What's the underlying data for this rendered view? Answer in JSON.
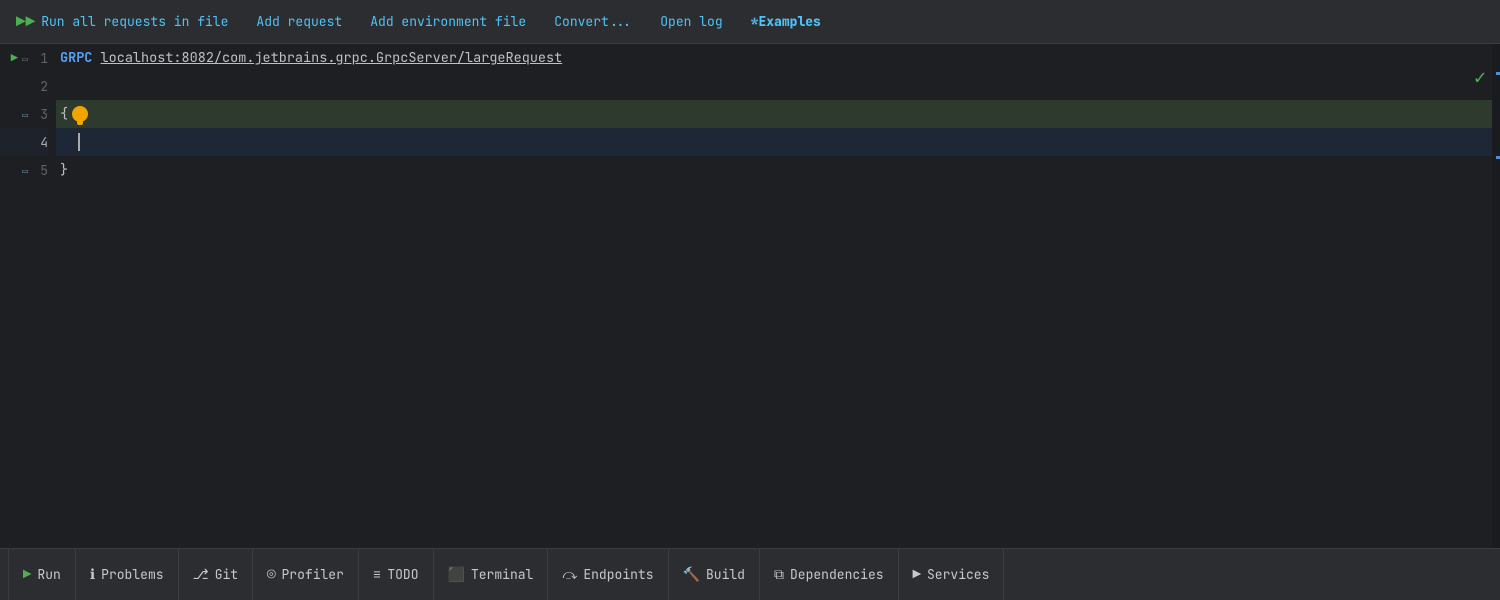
{
  "toolbar": {
    "run_all_label": "Run all requests in file",
    "add_request_label": "Add request",
    "add_env_label": "Add environment file",
    "convert_label": "Convert...",
    "open_log_label": "Open log",
    "examples_label": "*Examples"
  },
  "editor": {
    "line1": {
      "number": "1",
      "grpc_keyword": "GRPC",
      "url": "localhost:8082/com.jetbrains.grpc.GrpcServer/largeRequest"
    },
    "line2": {
      "number": "2"
    },
    "line3": {
      "number": "3",
      "content": "{"
    },
    "line4": {
      "number": "4"
    },
    "line5": {
      "number": "5",
      "content": "}"
    }
  },
  "statusbar": {
    "run_label": "Run",
    "problems_label": "Problems",
    "git_label": "Git",
    "profiler_label": "Profiler",
    "todo_label": "TODO",
    "terminal_label": "Terminal",
    "endpoints_label": "Endpoints",
    "build_label": "Build",
    "dependencies_label": "Dependencies",
    "services_label": "Services"
  }
}
